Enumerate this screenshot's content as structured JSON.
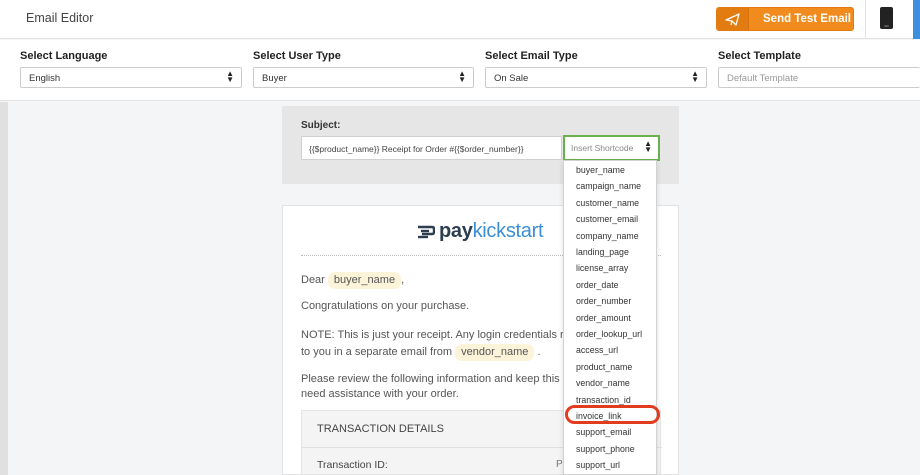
{
  "header": {
    "title": "Email Editor",
    "send_test_label": "Send Test Email"
  },
  "settings": {
    "language": {
      "label": "Select Language",
      "value": "English"
    },
    "user_type": {
      "label": "Select User Type",
      "value": "Buyer"
    },
    "email_type": {
      "label": "Select Email Type",
      "value": "On Sale"
    },
    "template": {
      "label": "Select Template",
      "placeholder": "Default Template"
    }
  },
  "subject": {
    "label": "Subject:",
    "value": "{{$product_name}} Receipt for Order #{{$order_number}}",
    "shortcode_placeholder": "Insert Shortcode"
  },
  "shortcodes": [
    "buyer_name",
    "campaign_name",
    "customer_name",
    "customer_email",
    "company_name",
    "landing_page",
    "license_array",
    "order_date",
    "order_number",
    "order_amount",
    "order_lookup_url",
    "access_url",
    "product_name",
    "vendor_name",
    "transaction_id",
    "invoice_link",
    "support_email",
    "support_phone",
    "support_url"
  ],
  "highlighted_shortcode": "invoice_link",
  "email": {
    "logo_bold": "pay",
    "logo_light": "kickstart",
    "dear_prefix": "Dear",
    "dear_tag": "buyer_name",
    "dear_suffix": ",",
    "congrats": "Congratulations on your purchase.",
    "note_line1": "NOTE: This is just your receipt. Any login credentials re",
    "note_line2_prefix": "to you in a separate email from",
    "note_tag": "vendor_name",
    "note_line2_suffix": ".",
    "review_line1": "Please review the following information and keep this",
    "review_line2": "need assistance with your order.",
    "details_header": "TRANSACTION DETAILS",
    "transaction_label": "Transaction ID:",
    "transaction_value": "PK"
  },
  "colors": {
    "accent": "#f18b1d",
    "focus": "#6ab04c",
    "highlight": "#e23b1e",
    "brand_blue": "#3a8fd6"
  }
}
